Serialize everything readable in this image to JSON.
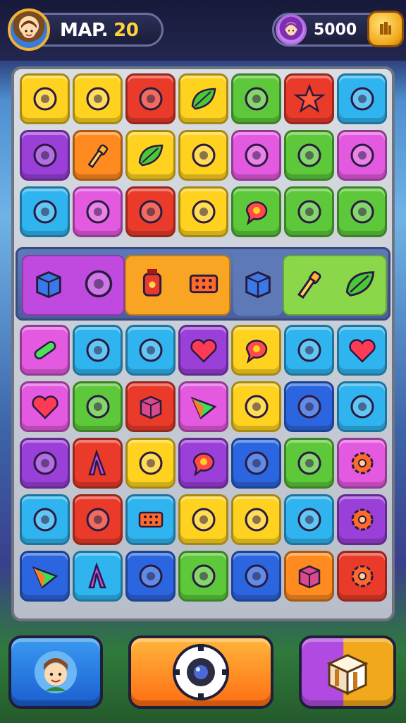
{
  "header": {
    "map_label": "MAP.",
    "map_number": "20",
    "coins": "5000",
    "coin_icon": "coin-icon"
  },
  "grid_top": [
    [
      "yellow",
      "yellow",
      "red",
      "yellow",
      "green",
      "red",
      "cyan"
    ],
    [
      "purple",
      "orange",
      "yellow",
      "yellow",
      "pink",
      "green",
      "pink"
    ],
    [
      "cyan",
      "pink",
      "red",
      "yellow",
      "green",
      "green",
      "green"
    ]
  ],
  "grid_bottom": [
    [
      "pink",
      "cyan",
      "cyan",
      "purple",
      "yellow",
      "cyan",
      "cyan"
    ],
    [
      "pink",
      "green",
      "red",
      "pink",
      "yellow",
      "blue",
      "cyan"
    ],
    [
      "purple",
      "red",
      "yellow",
      "purple",
      "blue",
      "green",
      "pink"
    ],
    [
      "cyan",
      "red",
      "cyan",
      "yellow",
      "yellow",
      "cyan",
      "purple"
    ],
    [
      "blue",
      "cyan",
      "blue",
      "green",
      "blue",
      "orange",
      "red"
    ]
  ],
  "icons_top": [
    [
      "log-icon",
      "key-icon",
      "slime-icon",
      "leaf-icon",
      "sponge-icon",
      "star-icon",
      "ring-icon"
    ],
    [
      "bird-icon",
      "hammer-icon",
      "leaf-icon",
      "shell-icon",
      "candy-icon",
      "bottle-icon",
      "calendar-icon"
    ],
    [
      "pin-icon",
      "boomerang-icon",
      "bubble-icon",
      "suitcase-icon",
      "chat-icon",
      "girl-face-icon",
      "sun-icon"
    ]
  ],
  "icons_bottom": [
    [
      "pill-icon",
      "stamp-icon",
      "bag-icon",
      "heart-icon",
      "chat-icon",
      "tag-icon",
      "heart-icon"
    ],
    [
      "heart-icon",
      "splat-icon",
      "box-icon",
      "triangle-icon",
      "sheep-icon",
      "feather-icon",
      "pencil-icon"
    ],
    [
      "lion-icon",
      "letter-a-icon",
      "croissant-icon",
      "chat-icon",
      "axe-icon",
      "lime-icon",
      "gear-icon"
    ],
    [
      "apple-icon",
      "chili-icon",
      "domino-icon",
      "plant-icon",
      "safe-icon",
      "button-icon",
      "gear-icon"
    ],
    [
      "triangle-icon",
      "letter-a-icon",
      "cat-icon",
      "donut-icon",
      "radio-icon",
      "box-icon",
      "gear-icon"
    ]
  ],
  "band": {
    "segments": [
      {
        "color": "#c04ae0",
        "icons": [
          "cube-icon",
          "stamp-icon"
        ]
      },
      {
        "color": "#f9a422",
        "icons": [
          "lantern-icon",
          "domino-icon"
        ]
      },
      {
        "color": "#5d79b8",
        "icons": [
          "cube-icon"
        ]
      },
      {
        "color": "#8ad84a",
        "icons": [
          "hammer-icon",
          "leaf-icon"
        ]
      }
    ]
  },
  "bottom": {
    "profile_icon": "avatar-icon",
    "play_icon": "play-icon",
    "shop_icon": "treasure-box-icon"
  },
  "colors": {
    "yellow": "#ffd21f",
    "red": "#ea3b2a",
    "green": "#5cc83a",
    "cyan": "#2fb4f0",
    "purple": "#9a3fd8",
    "orange": "#ff8a1f",
    "pink": "#e35ae0",
    "blue": "#2b66e0"
  }
}
